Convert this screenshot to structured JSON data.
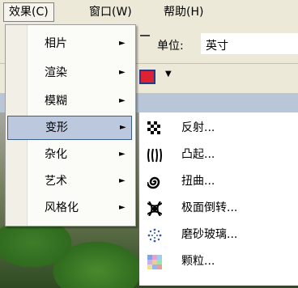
{
  "menubar": {
    "effect": "效果(C)",
    "window": "窗口(W)",
    "help": "帮助(H)"
  },
  "toolbar": {
    "unit_label": "单位:",
    "unit_value": "英寸"
  },
  "effects_menu": {
    "items": [
      {
        "label": "相片",
        "arrow": "►"
      },
      {
        "label": "渲染",
        "arrow": "►"
      },
      {
        "label": "模糊",
        "arrow": "►"
      },
      {
        "label": "变形",
        "arrow": "►"
      },
      {
        "label": "杂化",
        "arrow": "►"
      },
      {
        "label": "艺术",
        "arrow": "►"
      },
      {
        "label": "风格化",
        "arrow": "►"
      }
    ],
    "selected": "变形"
  },
  "distort_menu": {
    "items": [
      {
        "label": "反射...",
        "icon": "reflect-icon"
      },
      {
        "label": "凸起...",
        "icon": "bulge-icon"
      },
      {
        "label": "扭曲...",
        "icon": "twist-icon"
      },
      {
        "label": "极面倒转...",
        "icon": "polar-inversion-icon"
      },
      {
        "label": "磨砂玻璃...",
        "icon": "frosted-glass-icon"
      },
      {
        "label": "颗粒...",
        "icon": "grain-icon"
      }
    ]
  }
}
